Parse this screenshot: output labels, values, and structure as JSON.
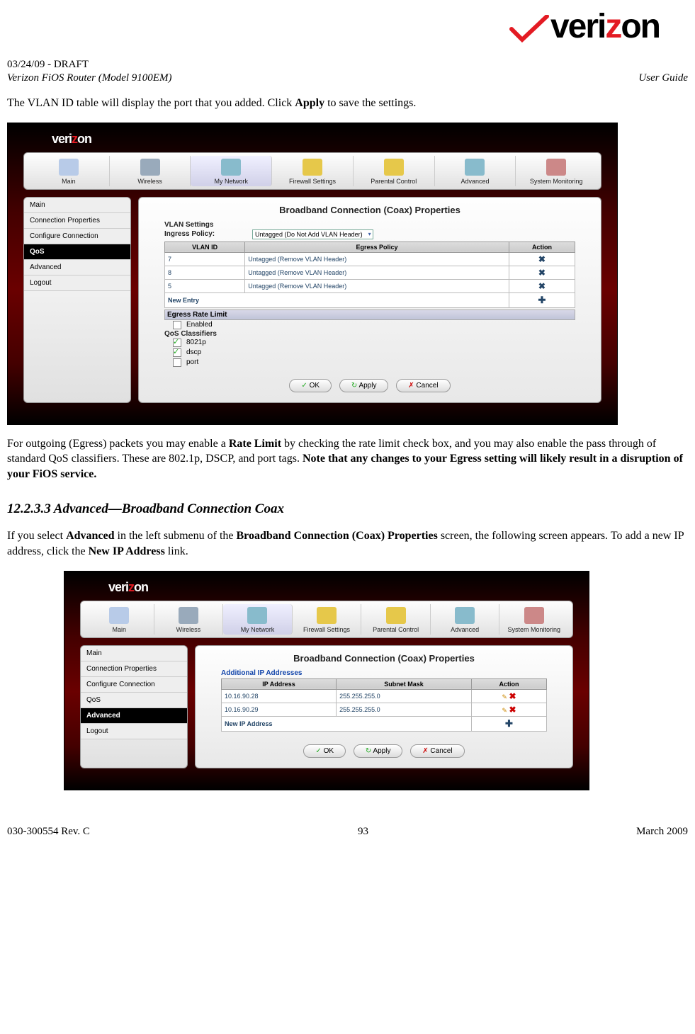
{
  "logo_text_pre": "veri",
  "logo_text_z": "z",
  "logo_text_post": "on",
  "draft_line": "03/24/09 - DRAFT",
  "header_left": "Verizon FiOS Router (Model 9100EM)",
  "header_right": "User Guide",
  "para1_pre": "The VLAN ID  table will display the port that you added. Click ",
  "para1_bold": "Apply",
  "para1_post": " to save the settings.",
  "screenshot1": {
    "nav": [
      "Main",
      "Wireless",
      "My Network",
      "Firewall Settings",
      "Parental Control",
      "Advanced",
      "System Monitoring"
    ],
    "nav_active": 2,
    "sidebar": [
      "Main",
      "Connection Properties",
      "Configure Connection",
      "QoS",
      "Advanced",
      "Logout"
    ],
    "sidebar_active": 3,
    "panel_title": "Broadband Connection (Coax) Properties",
    "vlan_settings_label": "VLAN Settings",
    "ingress_label": "Ingress Policy:",
    "ingress_value": "Untagged (Do Not Add VLAN Header)",
    "table_headers": [
      "VLAN ID",
      "Egress Policy",
      "Action"
    ],
    "rows": [
      {
        "id": "7",
        "policy": "Untagged (Remove VLAN Header)"
      },
      {
        "id": "8",
        "policy": "Untagged (Remove VLAN Header)"
      },
      {
        "id": "5",
        "policy": "Untagged (Remove VLAN Header)"
      }
    ],
    "new_entry": "New Entry",
    "egress_rate_label": "Egress Rate Limit",
    "enabled_label": "Enabled",
    "qos_label": "QoS Classifiers",
    "qos_items": [
      {
        "label": "8021p",
        "checked": true
      },
      {
        "label": "dscp",
        "checked": true
      },
      {
        "label": "port",
        "checked": false
      }
    ],
    "btn_ok": "OK",
    "btn_apply": "Apply",
    "btn_cancel": "Cancel"
  },
  "para2_a": "For outgoing (Egress) packets you may enable a ",
  "para2_b": "Rate Limit",
  "para2_c": " by checking the rate limit check box, and you may also enable the pass through of standard QoS classifiers. These are 802.1p, DSCP, and port tags. ",
  "para2_d": "Note that any changes to your Egress setting will likely result in a disruption of your FiOS service.",
  "section_num": "12.2.3.3",
  "section_title": "Advanced—Broadband Connection Coax",
  "para3_a": "If you select ",
  "para3_b": "Advanced",
  "para3_c": " in the left submenu of the ",
  "para3_d": "Broadband Connection (Coax) Properties",
  "para3_e": " screen, the following screen appears. To add a new IP address, click the ",
  "para3_f": "New IP Address",
  "para3_g": " link.",
  "screenshot2": {
    "nav": [
      "Main",
      "Wireless",
      "My Network",
      "Firewall Settings",
      "Parental Control",
      "Advanced",
      "System Monitoring"
    ],
    "nav_active": 2,
    "sidebar": [
      "Main",
      "Connection Properties",
      "Configure Connection",
      "QoS",
      "Advanced",
      "Logout"
    ],
    "sidebar_active": 4,
    "panel_title": "Broadband Connection (Coax) Properties",
    "addl_label": "Additional IP Addresses",
    "table_headers": [
      "IP Address",
      "Subnet Mask",
      "Action"
    ],
    "rows": [
      {
        "ip": "10.16.90.28",
        "mask": "255.255.255.0"
      },
      {
        "ip": "10.16.90.29",
        "mask": "255.255.255.0"
      }
    ],
    "new_ip": "New IP Address",
    "btn_ok": "OK",
    "btn_apply": "Apply",
    "btn_cancel": "Cancel"
  },
  "footer_left": "030-300554 Rev. C",
  "footer_center": "93",
  "footer_right": "March 2009"
}
